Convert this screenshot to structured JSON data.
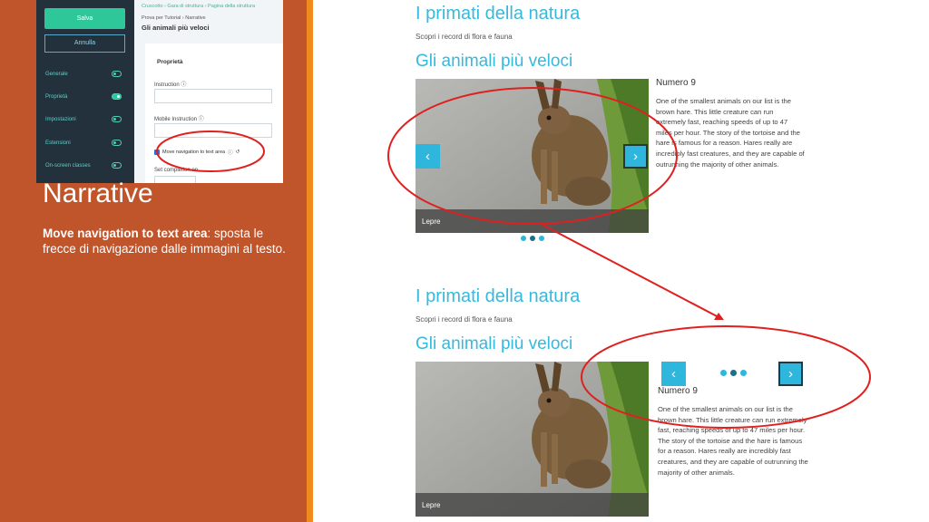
{
  "editor": {
    "save_label": "Salva",
    "cancel_label": "Annulla",
    "menu": [
      {
        "label": "Generale",
        "on": false
      },
      {
        "label": "Proprietà",
        "on": true
      },
      {
        "label": "Impostazioni",
        "on": false
      },
      {
        "label": "Estensioni",
        "on": false
      },
      {
        "label": "On-screen classes",
        "on": false
      }
    ],
    "breadcrumb": "Cruscotto  ›  Gara di struttura  ›  Pagina della struttura",
    "breadcrumb_sub": "Prova per Tutorial › Narrative",
    "title": "Gli animali più veloci",
    "section_title": "Proprietà",
    "instruction_label": "Instruction",
    "mobile_instruction_label": "Mobile Instruction",
    "checkbox_label": "Move navigation to text area",
    "completion_label": "Set completion on"
  },
  "slide": {
    "title": "Narrative",
    "bold": "Move navigation to text area",
    "text": ": sposta le frecce  di navigazione dalle immagini al testo."
  },
  "module": {
    "heading": "I primati della natura",
    "subheading": "Scopri i record di flora e fauna",
    "item_title": "Gli animali più veloci",
    "caption": "Lepre",
    "number": "Numero 9",
    "body": "One of the smallest animals on our list is the brown hare. This little creature can run extremely fast, reaching speeds of up to 47 miles per hour. The story of the tortoise and the hare is famous for a reason. Hares really are incredibly fast creatures, and they are capable of outrunning the majority of other animals.",
    "prev_icon": "‹",
    "next_icon": "›"
  },
  "colors": {
    "accent": "#35b9dd",
    "slide_bg": "#c0542a",
    "annotation": "#e01f1f"
  }
}
